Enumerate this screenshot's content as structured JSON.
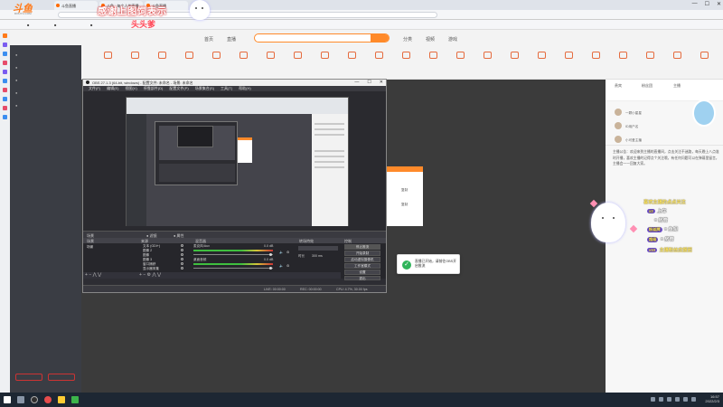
{
  "browser": {
    "tabs": [
      "斗鱼直播",
      "斗鱼 - 每个人的直播",
      "斗鱼直播"
    ],
    "window_controls": [
      "—",
      "☐",
      "✕"
    ]
  },
  "site": {
    "logo": "斗鱼",
    "logo_sub": "DOUYU.COM",
    "nav": [
      "首页",
      "直播",
      "分类",
      "视频",
      "游戏"
    ]
  },
  "banner": {
    "title": "感谢上图饲表示",
    "subtitle": "头头爹"
  },
  "obs": {
    "title": "OBS 27.1.3 (64-bit, windows) - 配置文件: 未命名 - 场景: 未命名",
    "menu": [
      "文件(F)",
      "编辑(E)",
      "视图(V)",
      "停靠部件(D)",
      "配置文件(P)",
      "场景集合(S)",
      "工具(T)",
      "帮助(H)"
    ],
    "docks": {
      "scenes": "场景",
      "sources": "来源",
      "mixer": "混音器",
      "transitions": "转场特效",
      "controls": "控制"
    },
    "scene_items": [
      "场景"
    ],
    "sources": [
      "文本 (GDI+)",
      "图像 2",
      "图像",
      "图像 3",
      "窗口捕获",
      "显示器采集"
    ],
    "mixer_channels": [
      {
        "name": "麦克风/Aux",
        "value": "0.0 dB"
      },
      {
        "name": "桌面音频",
        "value": "0.0 dB"
      }
    ],
    "transition_label": "时长",
    "transition_value": "300 ms",
    "controls": [
      "停止推流",
      "开始录制",
      "启动虚拟摄像机",
      "工作室模式",
      "设置",
      "退出"
    ],
    "status": [
      "LIVE: 00:00:00",
      "REC: 00:00:00",
      "CPU: 4.7%, 30.00 fps"
    ]
  },
  "toast": {
    "icon": "✓",
    "text": "直播已开始，请前往OBS开启推流"
  },
  "orange_dialog": [
    "复制",
    "复制"
  ],
  "chat_panel": {
    "tabs": [
      "贵宾",
      "粉丝团",
      "主播"
    ],
    "ranks": [
      "一颗小星星",
      "ID用户名",
      "小可爱主播"
    ],
    "notice": "主播公告：欢迎来到主播的直播间，点击关注不迷路，每天晚上八点准时开播，喜欢主播的记得点个关注哦，有任何问题可以在弹幕里留言，主播会一一回复大家。"
  },
  "gift_overlay": {
    "line1": "喜欢主播的点点关注",
    "line2_tag": "x2",
    "line2": "上车",
    "line3": "= 房管",
    "line4_tag": "粉丝牌",
    "line4": "= 鱼翅",
    "line5_tag": "超级",
    "line5": "= 房管",
    "line6_tag": "x10",
    "line6": "主播粉丝应援团"
  },
  "taskbar": {
    "clock_time": "16:57",
    "clock_date": "2022/2/3"
  },
  "colors": {
    "accent": "#ff8a2a",
    "obs_bg": "#2d2d33",
    "success": "#2fb45a"
  }
}
